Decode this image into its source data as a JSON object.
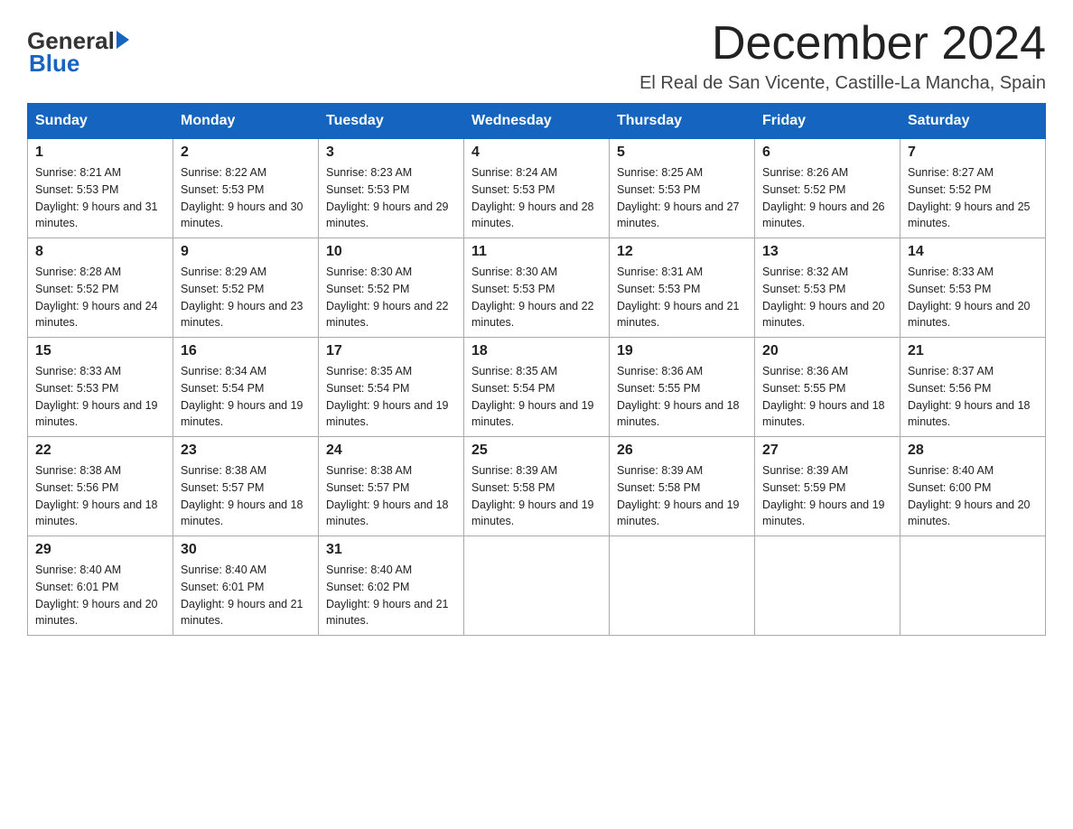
{
  "header": {
    "logo_general": "General",
    "logo_arrow": "▶",
    "logo_blue": "Blue",
    "month_title": "December 2024",
    "subtitle": "El Real de San Vicente, Castille-La Mancha, Spain"
  },
  "days_of_week": [
    "Sunday",
    "Monday",
    "Tuesday",
    "Wednesday",
    "Thursday",
    "Friday",
    "Saturday"
  ],
  "weeks": [
    [
      {
        "day": "1",
        "sunrise": "8:21 AM",
        "sunset": "5:53 PM",
        "daylight": "9 hours and 31 minutes."
      },
      {
        "day": "2",
        "sunrise": "8:22 AM",
        "sunset": "5:53 PM",
        "daylight": "9 hours and 30 minutes."
      },
      {
        "day": "3",
        "sunrise": "8:23 AM",
        "sunset": "5:53 PM",
        "daylight": "9 hours and 29 minutes."
      },
      {
        "day": "4",
        "sunrise": "8:24 AM",
        "sunset": "5:53 PM",
        "daylight": "9 hours and 28 minutes."
      },
      {
        "day": "5",
        "sunrise": "8:25 AM",
        "sunset": "5:53 PM",
        "daylight": "9 hours and 27 minutes."
      },
      {
        "day": "6",
        "sunrise": "8:26 AM",
        "sunset": "5:52 PM",
        "daylight": "9 hours and 26 minutes."
      },
      {
        "day": "7",
        "sunrise": "8:27 AM",
        "sunset": "5:52 PM",
        "daylight": "9 hours and 25 minutes."
      }
    ],
    [
      {
        "day": "8",
        "sunrise": "8:28 AM",
        "sunset": "5:52 PM",
        "daylight": "9 hours and 24 minutes."
      },
      {
        "day": "9",
        "sunrise": "8:29 AM",
        "sunset": "5:52 PM",
        "daylight": "9 hours and 23 minutes."
      },
      {
        "day": "10",
        "sunrise": "8:30 AM",
        "sunset": "5:52 PM",
        "daylight": "9 hours and 22 minutes."
      },
      {
        "day": "11",
        "sunrise": "8:30 AM",
        "sunset": "5:53 PM",
        "daylight": "9 hours and 22 minutes."
      },
      {
        "day": "12",
        "sunrise": "8:31 AM",
        "sunset": "5:53 PM",
        "daylight": "9 hours and 21 minutes."
      },
      {
        "day": "13",
        "sunrise": "8:32 AM",
        "sunset": "5:53 PM",
        "daylight": "9 hours and 20 minutes."
      },
      {
        "day": "14",
        "sunrise": "8:33 AM",
        "sunset": "5:53 PM",
        "daylight": "9 hours and 20 minutes."
      }
    ],
    [
      {
        "day": "15",
        "sunrise": "8:33 AM",
        "sunset": "5:53 PM",
        "daylight": "9 hours and 19 minutes."
      },
      {
        "day": "16",
        "sunrise": "8:34 AM",
        "sunset": "5:54 PM",
        "daylight": "9 hours and 19 minutes."
      },
      {
        "day": "17",
        "sunrise": "8:35 AM",
        "sunset": "5:54 PM",
        "daylight": "9 hours and 19 minutes."
      },
      {
        "day": "18",
        "sunrise": "8:35 AM",
        "sunset": "5:54 PM",
        "daylight": "9 hours and 19 minutes."
      },
      {
        "day": "19",
        "sunrise": "8:36 AM",
        "sunset": "5:55 PM",
        "daylight": "9 hours and 18 minutes."
      },
      {
        "day": "20",
        "sunrise": "8:36 AM",
        "sunset": "5:55 PM",
        "daylight": "9 hours and 18 minutes."
      },
      {
        "day": "21",
        "sunrise": "8:37 AM",
        "sunset": "5:56 PM",
        "daylight": "9 hours and 18 minutes."
      }
    ],
    [
      {
        "day": "22",
        "sunrise": "8:38 AM",
        "sunset": "5:56 PM",
        "daylight": "9 hours and 18 minutes."
      },
      {
        "day": "23",
        "sunrise": "8:38 AM",
        "sunset": "5:57 PM",
        "daylight": "9 hours and 18 minutes."
      },
      {
        "day": "24",
        "sunrise": "8:38 AM",
        "sunset": "5:57 PM",
        "daylight": "9 hours and 18 minutes."
      },
      {
        "day": "25",
        "sunrise": "8:39 AM",
        "sunset": "5:58 PM",
        "daylight": "9 hours and 19 minutes."
      },
      {
        "day": "26",
        "sunrise": "8:39 AM",
        "sunset": "5:58 PM",
        "daylight": "9 hours and 19 minutes."
      },
      {
        "day": "27",
        "sunrise": "8:39 AM",
        "sunset": "5:59 PM",
        "daylight": "9 hours and 19 minutes."
      },
      {
        "day": "28",
        "sunrise": "8:40 AM",
        "sunset": "6:00 PM",
        "daylight": "9 hours and 20 minutes."
      }
    ],
    [
      {
        "day": "29",
        "sunrise": "8:40 AM",
        "sunset": "6:01 PM",
        "daylight": "9 hours and 20 minutes."
      },
      {
        "day": "30",
        "sunrise": "8:40 AM",
        "sunset": "6:01 PM",
        "daylight": "9 hours and 21 minutes."
      },
      {
        "day": "31",
        "sunrise": "8:40 AM",
        "sunset": "6:02 PM",
        "daylight": "9 hours and 21 minutes."
      },
      null,
      null,
      null,
      null
    ]
  ]
}
